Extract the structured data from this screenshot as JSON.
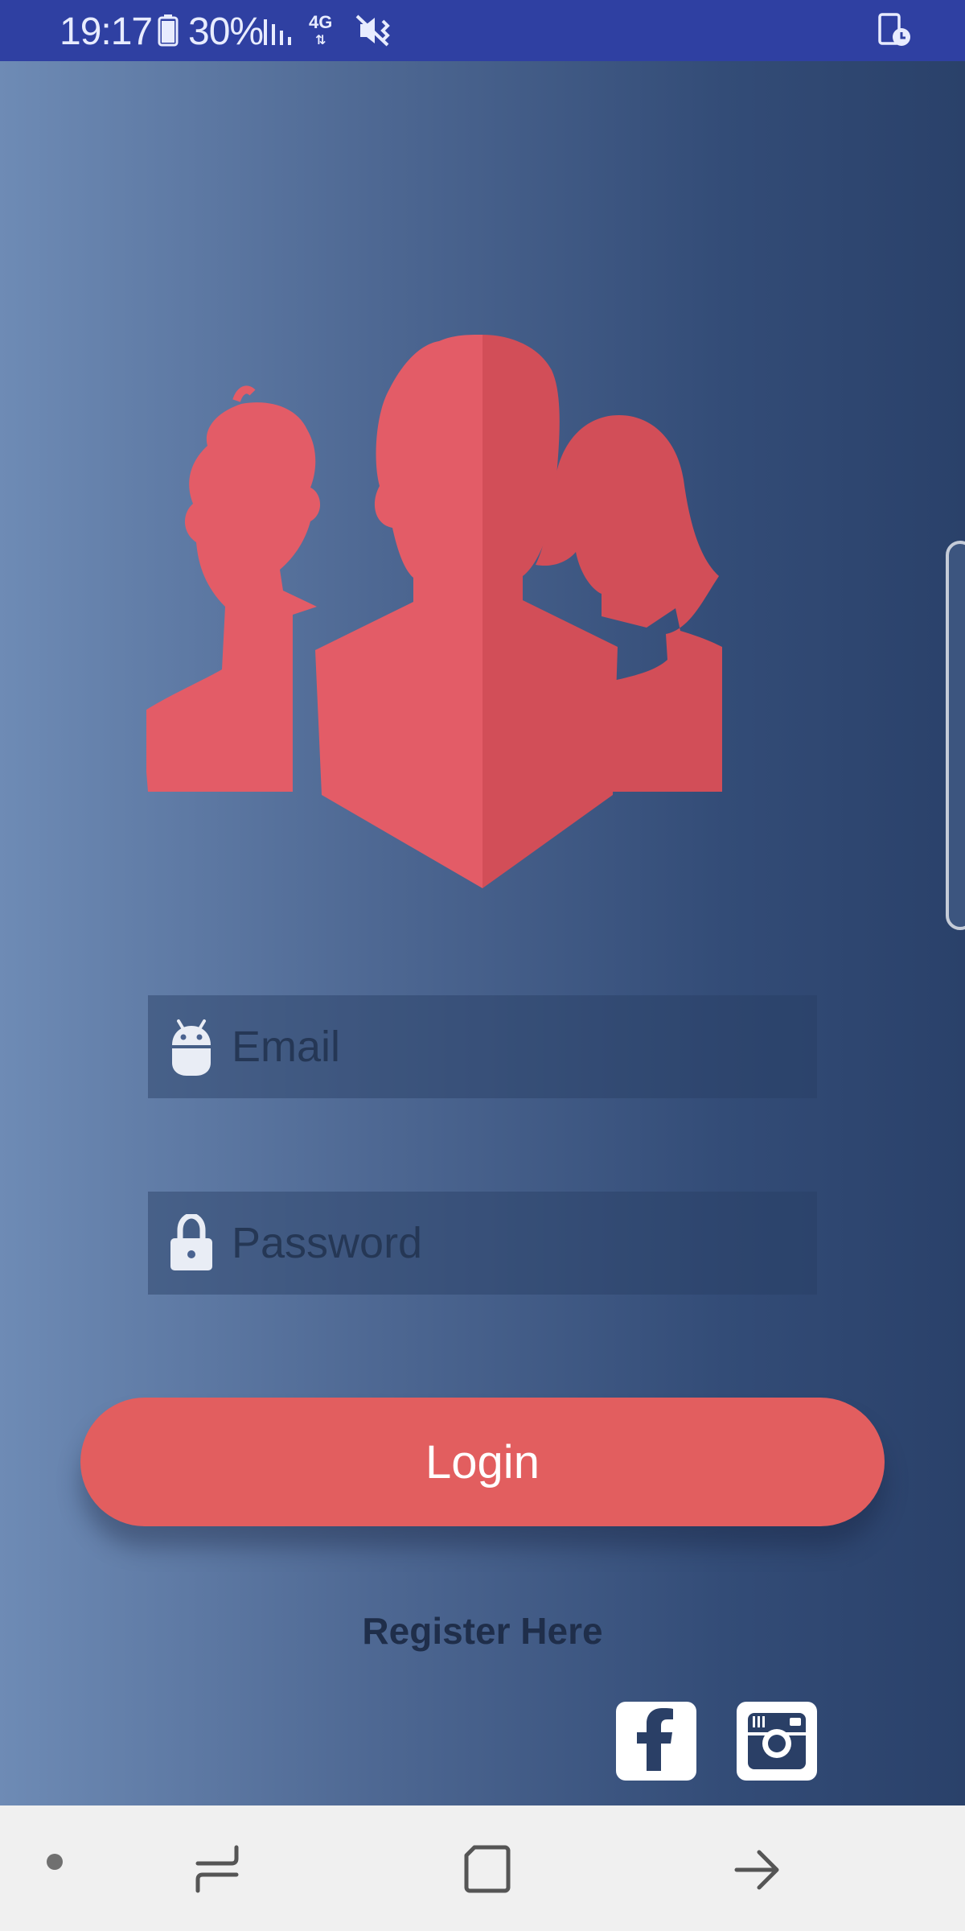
{
  "status_bar": {
    "time": "19:17",
    "battery_percent": "30%",
    "network": "4G"
  },
  "form": {
    "email_placeholder": "Email",
    "password_placeholder": "Password"
  },
  "buttons": {
    "login_label": "Login",
    "register_label": "Register Here"
  },
  "icons": {
    "logo": "users-group-icon",
    "email": "android-icon",
    "password": "lock-icon",
    "social": [
      "facebook-icon",
      "instagram-icon"
    ],
    "nav": [
      "dot-icon",
      "recent-apps-icon",
      "home-icon",
      "back-icon"
    ]
  },
  "colors": {
    "status_bar": "#2f40a2",
    "accent": "#e25e5f",
    "background_start": "#6e8bb5",
    "background_end": "#2a416a",
    "nav_bar": "#f0f0f0"
  }
}
